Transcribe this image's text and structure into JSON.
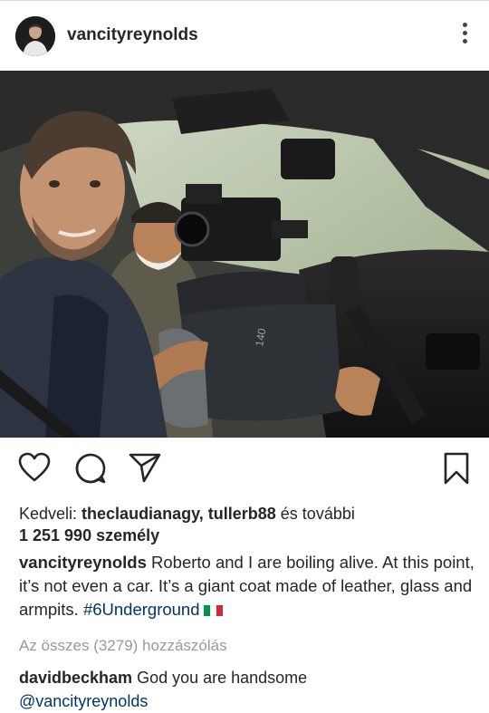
{
  "post": {
    "username": "vancityreynolds"
  },
  "icons": {
    "more": "more-vertical-icon",
    "like": "heart-icon",
    "comment": "comment-icon",
    "share": "paper-plane-icon",
    "save": "bookmark-icon"
  },
  "likes": {
    "prefix": "Kedveli: ",
    "user1": "theclaudianagy",
    "sep": ", ",
    "user2": "tullerb88",
    "suffix": " és további",
    "count": "1 251 990 személy"
  },
  "caption": {
    "username": "vancityreynolds",
    "text": " Roberto and I are boiling alive. At this point, it’s not even a car. It’s a giant coat made of leather, glass and armpits. ",
    "hashtag": "#6Underground"
  },
  "comments": {
    "view_all": "Az összes (3279) hozzászólás",
    "items": [
      {
        "username": "davidbeckham",
        "text": " God you are handsome",
        "mention": "@vancityreynolds"
      }
    ]
  },
  "colors": {
    "text": "#262626",
    "link": "#003569",
    "muted": "#999999",
    "flag": [
      "#009246",
      "#ffffff",
      "#ce2b37"
    ]
  }
}
